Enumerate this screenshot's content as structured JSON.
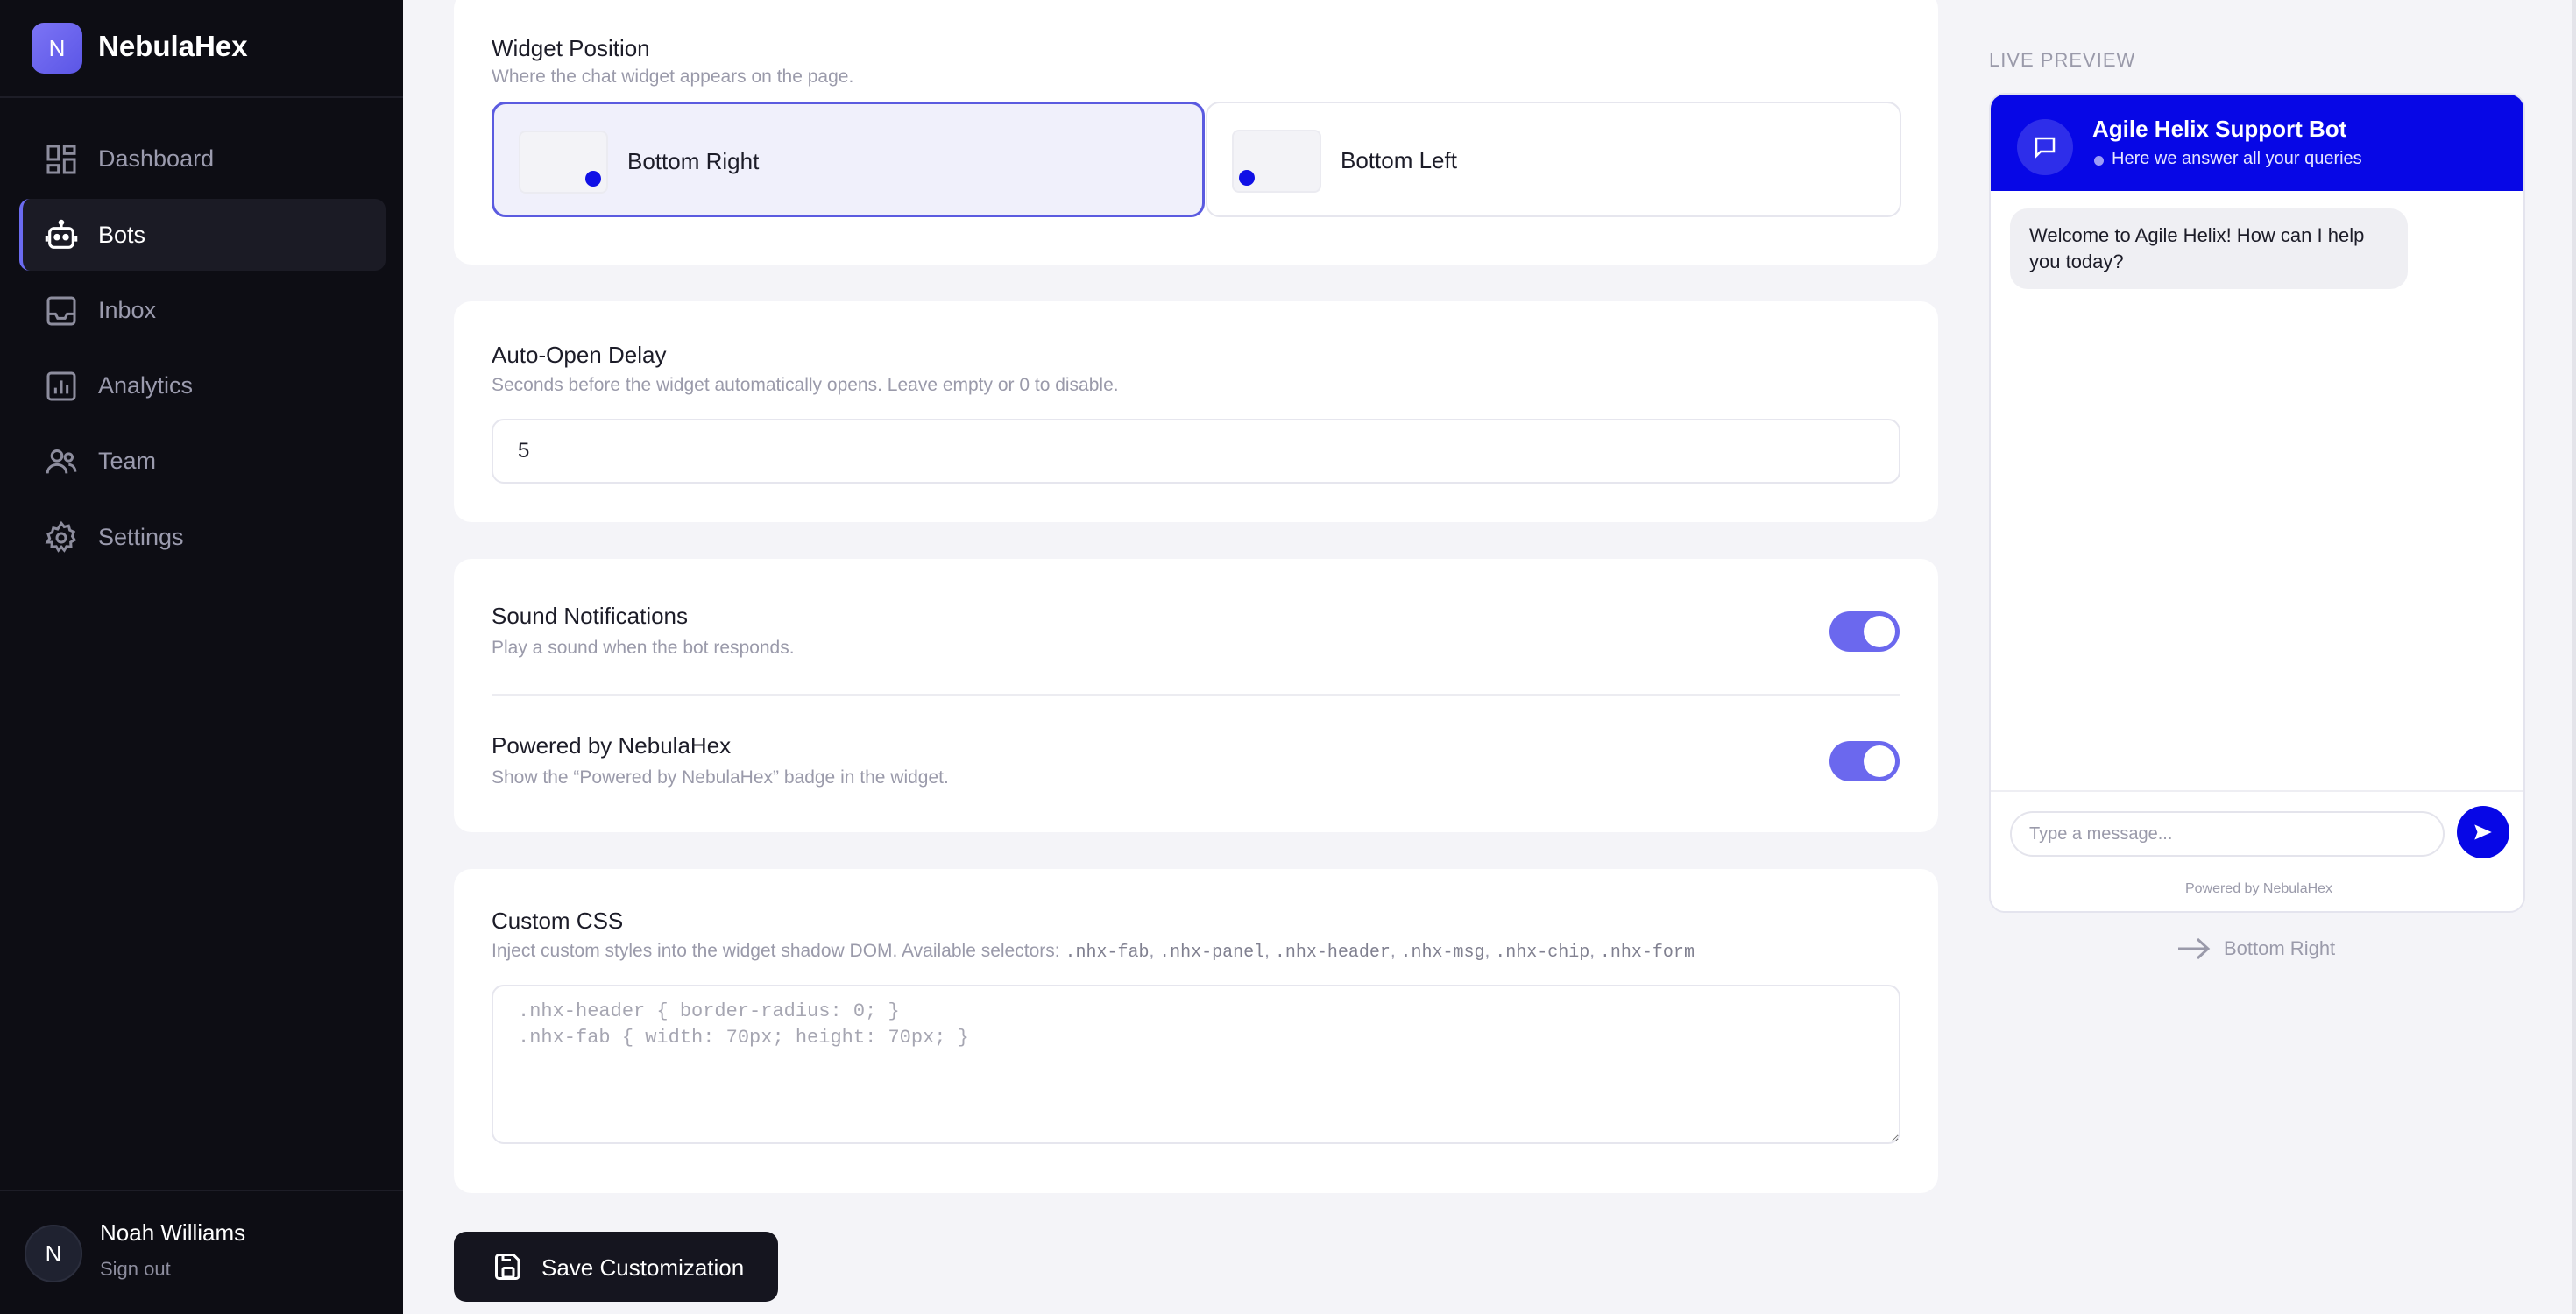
{
  "brand": {
    "logo_letter": "N",
    "name": "NebulaHex"
  },
  "nav": {
    "items": [
      {
        "label": "Dashboard",
        "icon": "dashboard-icon"
      },
      {
        "label": "Bots",
        "icon": "bot-icon",
        "active": true
      },
      {
        "label": "Inbox",
        "icon": "inbox-icon"
      },
      {
        "label": "Analytics",
        "icon": "analytics-icon"
      },
      {
        "label": "Team",
        "icon": "team-icon"
      },
      {
        "label": "Settings",
        "icon": "settings-icon"
      }
    ]
  },
  "user": {
    "initial": "N",
    "name": "Noah Williams",
    "signout": "Sign out"
  },
  "widget_position": {
    "title": "Widget Position",
    "subtitle": "Where the chat widget appears on the page.",
    "options": [
      {
        "label": "Bottom Right",
        "selected": true
      },
      {
        "label": "Bottom Left",
        "selected": false
      }
    ]
  },
  "auto_open": {
    "title": "Auto-Open Delay",
    "subtitle": "Seconds before the widget automatically opens. Leave empty or 0 to disable.",
    "value": "5"
  },
  "sound": {
    "title": "Sound Notifications",
    "subtitle": "Play a sound when the bot responds.",
    "enabled": true
  },
  "powered_by": {
    "title": "Powered by NebulaHex",
    "subtitle": "Show the “Powered by NebulaHex” badge in the widget.",
    "enabled": true
  },
  "custom_css": {
    "title": "Custom CSS",
    "subtitle_prefix": "Inject custom styles into the widget shadow DOM. Available selectors:",
    "selectors": [
      ".nhx-fab",
      ".nhx-panel",
      ".nhx-header",
      ".nhx-msg",
      ".nhx-chip",
      ".nhx-form"
    ],
    "placeholder": ".nhx-header { border-radius: 0; }\n.nhx-fab { width: 70px; height: 70px; }"
  },
  "save_button": {
    "label": "Save Customization"
  },
  "preview": {
    "label": "LIVE PREVIEW",
    "bot_name": "Agile Helix Support Bot",
    "status": "Here we answer all your queries",
    "welcome": "Welcome to Agile Helix! How can I help you today?",
    "input_placeholder": "Type a message...",
    "powered": "Powered by NebulaHex",
    "position_label": "Bottom Right",
    "header_color": "#0707e6"
  },
  "colors": {
    "accent": "#5b5be0",
    "toggle_on": "#6b68ee",
    "sidebar_bg": "#0d0d14"
  }
}
